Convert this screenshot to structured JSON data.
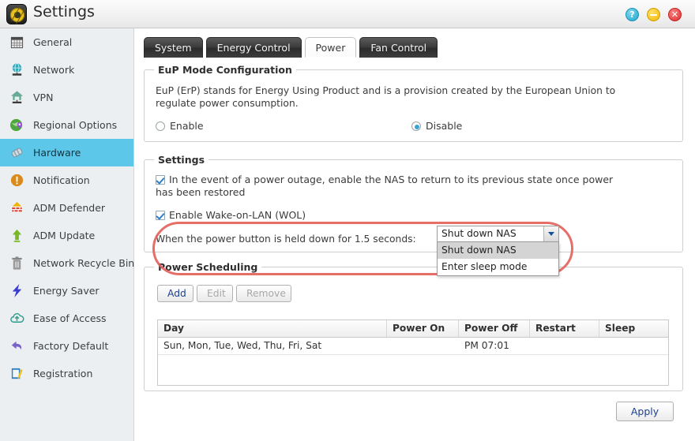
{
  "window": {
    "title": "Settings",
    "app_icon": "settings-gear-icon",
    "controls": [
      {
        "name": "help-button",
        "glyph": "?"
      },
      {
        "name": "minimize-button",
        "glyph": "–"
      },
      {
        "name": "close-button",
        "glyph": "✕"
      }
    ]
  },
  "sidebar": {
    "items": [
      {
        "label": "General",
        "icon": "calendar-icon",
        "selected": false
      },
      {
        "label": "Network",
        "icon": "globe-network-icon",
        "selected": false
      },
      {
        "label": "VPN",
        "icon": "house-network-icon",
        "selected": false
      },
      {
        "label": "Regional Options",
        "icon": "globe-pin-icon",
        "selected": false
      },
      {
        "label": "Hardware",
        "icon": "hardware-chip-icon",
        "selected": true
      },
      {
        "label": "Notification",
        "icon": "exclamation-circle-icon",
        "selected": false
      },
      {
        "label": "ADM Defender",
        "icon": "firewall-icon",
        "selected": false
      },
      {
        "label": "ADM Update",
        "icon": "up-arrow-icon",
        "selected": false
      },
      {
        "label": "Network Recycle Bin",
        "icon": "trash-icon",
        "selected": false
      },
      {
        "label": "Energy Saver",
        "icon": "lightning-bolt-icon",
        "selected": false
      },
      {
        "label": "Ease of Access",
        "icon": "cloud-upload-icon",
        "selected": false
      },
      {
        "label": "Factory Default",
        "icon": "undo-arrow-icon",
        "selected": false
      },
      {
        "label": "Registration",
        "icon": "clipboard-pencil-icon",
        "selected": false
      }
    ]
  },
  "tabs": [
    {
      "label": "System",
      "active": false
    },
    {
      "label": "Energy Control",
      "active": false
    },
    {
      "label": "Power",
      "active": true
    },
    {
      "label": "Fan Control",
      "active": false
    }
  ],
  "eup": {
    "legend": "EuP Mode Configuration",
    "description": "EuP (ErP) stands for Energy Using Product and is a provision created by the European Union to regulate power consumption.",
    "enable_label": "Enable",
    "disable_label": "Disable",
    "selected": "Disable"
  },
  "settings": {
    "legend": "Settings",
    "power_outage_label": "In the event of a power outage, enable the NAS to return to its previous state once power has been restored",
    "power_outage_checked": true,
    "wol_label": "Enable Wake-on-LAN (WOL)",
    "wol_checked": true,
    "power_button_label": "When the power button is held down for 1.5 seconds:",
    "power_button_value": "Shut down NAS",
    "power_button_options": [
      "Shut down NAS",
      "Enter sleep mode"
    ],
    "power_button_highlighted_option": "Shut down NAS",
    "dropdown_open": true
  },
  "scheduling": {
    "legend": "Power Scheduling",
    "buttons": [
      {
        "label": "Add",
        "enabled": true
      },
      {
        "label": "Edit",
        "enabled": false
      },
      {
        "label": "Remove",
        "enabled": false
      }
    ],
    "columns": [
      "Day",
      "Power On",
      "Power Off",
      "Restart",
      "Sleep"
    ],
    "rows": [
      {
        "day": "Sun, Mon, Tue, Wed, Thu, Fri, Sat",
        "power_on": "",
        "power_off": "PM 07:01",
        "restart": "",
        "sleep": ""
      }
    ]
  },
  "footer": {
    "apply_label": "Apply"
  },
  "colors": {
    "accent_selected": "#5cc7e8",
    "annotation_red": "#e4625c",
    "link_blue": "#1c3f8f",
    "checkbox_blue": "#2f7fc4"
  }
}
